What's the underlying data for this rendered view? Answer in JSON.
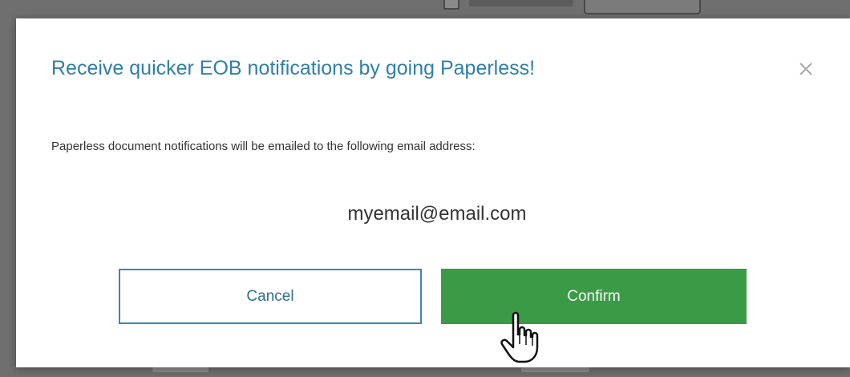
{
  "modal": {
    "title": "Receive quicker EOB notifications by going Paperless!",
    "close_icon": "close-icon",
    "body_text": "Paperless document notifications will be emailed to the following email address:",
    "email": "myemail@email.com"
  },
  "buttons": {
    "cancel_label": "Cancel",
    "confirm_label": "Confirm"
  },
  "colors": {
    "title": "#2f7fa8",
    "cancel_border": "#3b86b3",
    "confirm_bg": "#3a9a45",
    "backdrop": "#6f6f6f"
  },
  "cursor": {
    "icon": "hand-pointer-icon"
  }
}
